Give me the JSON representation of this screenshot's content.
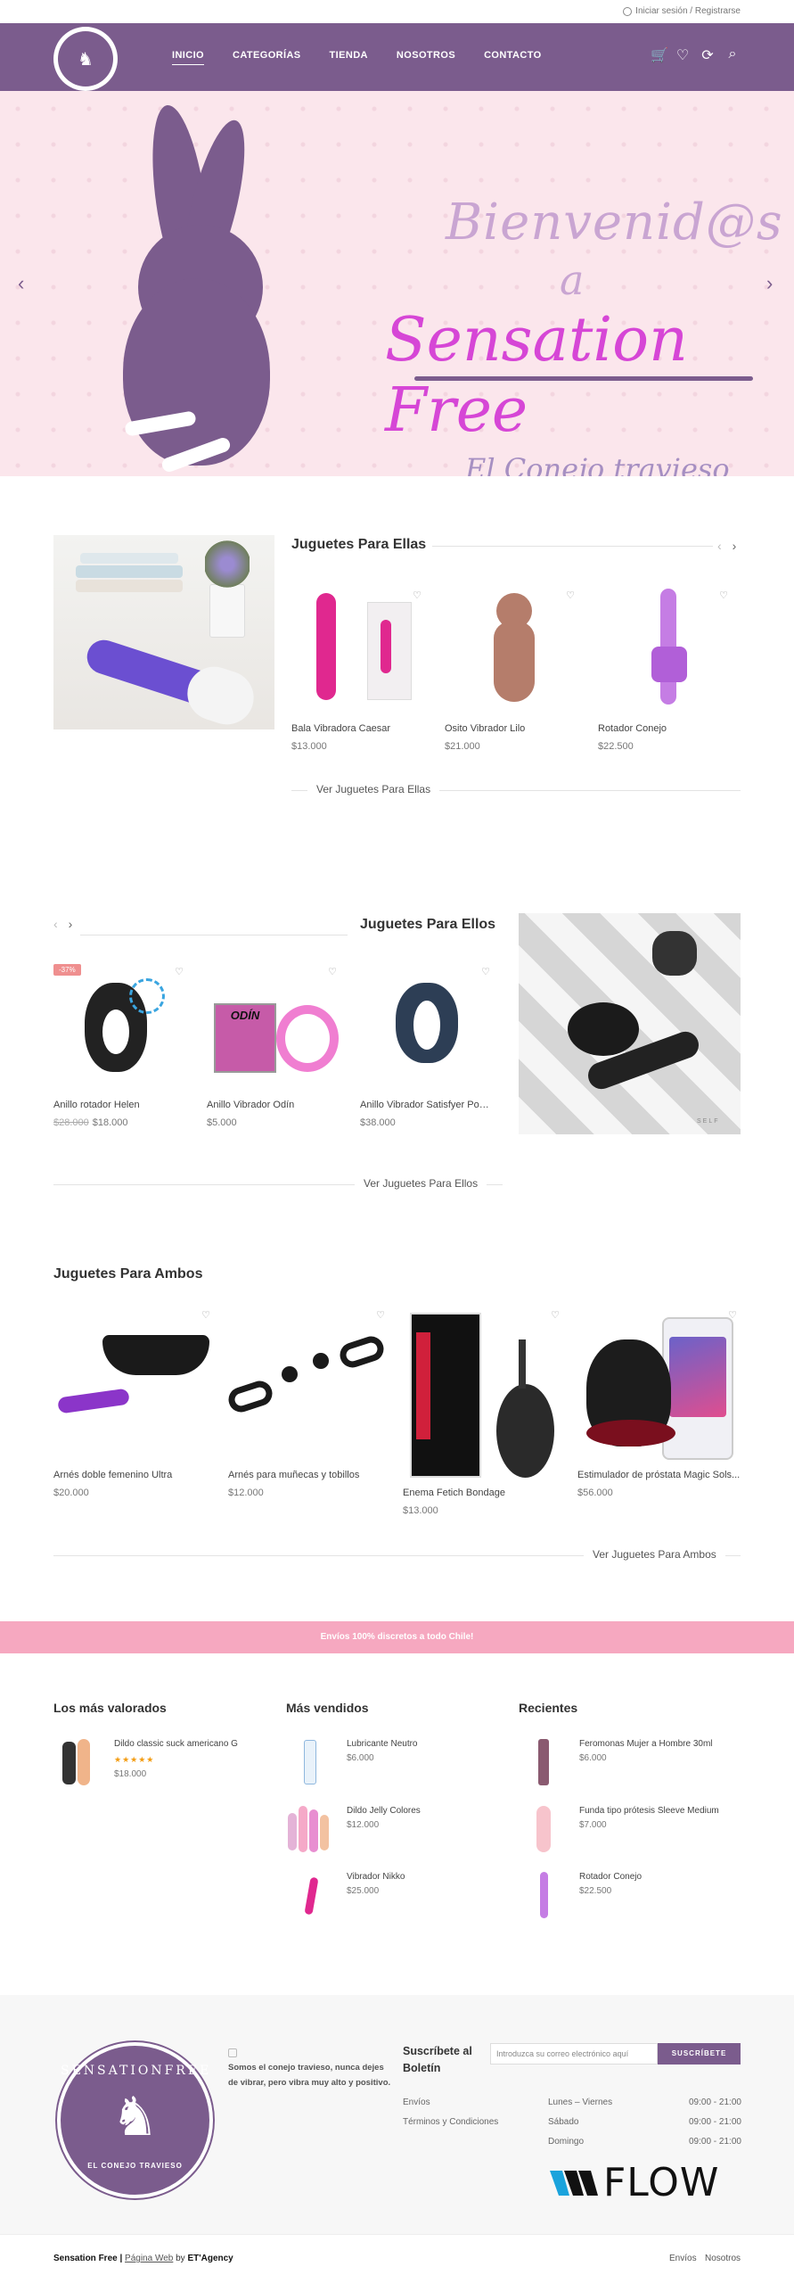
{
  "topbar": {
    "login_text": "Iniciar sesión / Registrarse"
  },
  "nav": {
    "items": [
      "INICIO",
      "CATEGORÍAS",
      "TIENDA",
      "NOSOTROS",
      "CONTACTO"
    ]
  },
  "icons": {
    "cart": "cart-icon",
    "wishlist": "heart-icon",
    "compare": "refresh-icon",
    "search": "search-icon"
  },
  "hero": {
    "line1": "Bienvenid@s",
    "line2": "a",
    "line3": "Sensation Free",
    "line4": "El Conejo travieso"
  },
  "ellas": {
    "title": "Juguetes Para Ellas",
    "see_all": "Ver Juguetes Para Ellas",
    "products": [
      {
        "name": "Bala Vibradora Caesar",
        "price": "$13.000"
      },
      {
        "name": "Osito Vibrador Lilo",
        "price": "$21.000"
      },
      {
        "name": "Rotador Conejo",
        "price": "$22.500"
      }
    ]
  },
  "ellos": {
    "title": "Juguetes Para Ellos",
    "see_all": "Ver Juguetes Para Ellos",
    "products": [
      {
        "name": "Anillo rotador Helen",
        "old_price": "$28.000",
        "price": "$18.000",
        "badge": "-37%"
      },
      {
        "name": "Anillo Vibrador Odín",
        "price": "$5.000"
      },
      {
        "name": "Anillo Vibrador Satisfyer Powe...",
        "price": "$38.000"
      }
    ],
    "odin_label": "ODÍN",
    "image_caption": "SELF"
  },
  "ambos": {
    "title": "Juguetes Para Ambos",
    "see_all": "Ver Juguetes Para Ambos",
    "products": [
      {
        "name": "Arnés doble femenino Ultra",
        "price": "$20.000"
      },
      {
        "name": "Arnés para muñecas y tobillos",
        "price": "$12.000"
      },
      {
        "name": "Enema Fetich Bondage",
        "price": "$13.000"
      },
      {
        "name": "Estimulador de próstata Magic Sols...",
        "price": "$56.000"
      }
    ]
  },
  "banner": {
    "text": "Envíos 100% discretos a todo Chile!"
  },
  "lists": {
    "valorados": {
      "title": "Los más valorados",
      "items": [
        {
          "name": "Dildo classic suck americano G",
          "price": "$18.000",
          "stars": "★★★★★"
        }
      ]
    },
    "vendidos": {
      "title": "Más vendidos",
      "items": [
        {
          "name": "Lubricante Neutro",
          "price": "$6.000"
        },
        {
          "name": "Dildo Jelly Colores",
          "price": "$12.000"
        },
        {
          "name": "Vibrador Nikko",
          "price": "$25.000"
        }
      ]
    },
    "recientes": {
      "title": "Recientes",
      "items": [
        {
          "name": "Feromonas Mujer a Hombre 30ml",
          "price": "$6.000"
        },
        {
          "name": "Funda tipo prótesis Sleeve Medium",
          "price": "$7.000"
        },
        {
          "name": "Rotador Conejo",
          "price": "$22.500"
        }
      ]
    }
  },
  "footer": {
    "logo_top": "SENSATIONFREE",
    "logo_bottom": "EL CONEJO TRAVIESO",
    "desc": "Somos el conejo travieso, nunca dejes de vibrar, pero vibra muy alto y positivo.",
    "newsletter_title": "Suscríbete al Boletín",
    "email_placeholder": "Introduzca su correo electrónico aquí",
    "subscribe": "SUSCRÍBETE",
    "links": [
      "Envíos",
      "Términos y Condiciones"
    ],
    "hours": [
      {
        "day": "Lunes – Viernes",
        "time": "09:00 - 21:00"
      },
      {
        "day": "Sábado",
        "time": "09:00 - 21:00"
      },
      {
        "day": "Domingo",
        "time": "09:00 - 21:00"
      }
    ],
    "flow_brand": "FLOW"
  },
  "bottom": {
    "brand": "Sensation Free |",
    "web_link": "Página Web",
    "by": "by",
    "agency": "ET'Agency",
    "links": [
      "Envíos",
      "Nosotros"
    ]
  },
  "colors": {
    "brand_purple": "#7b5c8d",
    "banner_pink": "#f6a8c0",
    "hero_magenta": "#d646d6"
  }
}
